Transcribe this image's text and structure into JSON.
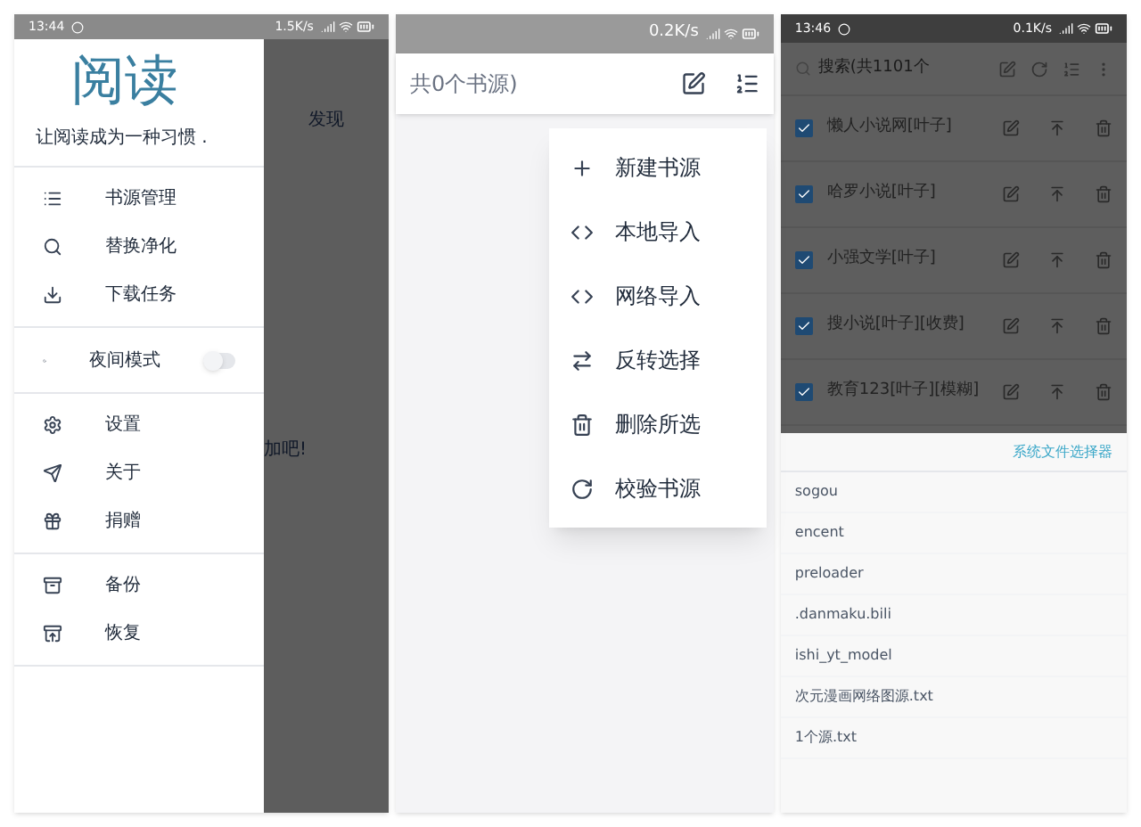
{
  "left_phone": {
    "status_bar": {
      "time": "13:44",
      "speed": "1.5K/s"
    },
    "drawer": {
      "title": "阅读",
      "subtitle": "让阅读成为一种习惯 .",
      "sections": [
        {
          "items": [
            {
              "kind": "link",
              "label": "书源管理"
            },
            {
              "kind": "link",
              "label": "替换净化"
            },
            {
              "kind": "link",
              "label": "下载任务"
            }
          ]
        },
        {
          "items": [
            {
              "kind": "toggle",
              "label": "夜间模式",
              "on": false
            }
          ]
        },
        {
          "items": [
            {
              "kind": "link",
              "label": "设置"
            },
            {
              "kind": "link",
              "label": "关于"
            },
            {
              "kind": "link",
              "label": "捐赠"
            }
          ]
        },
        {
          "items": [
            {
              "kind": "link",
              "label": "备份"
            },
            {
              "kind": "link",
              "label": "恢复"
            }
          ]
        }
      ]
    },
    "background": {
      "tab": "发现",
      "message": "加吧!"
    }
  },
  "middle_phone": {
    "status_bar": {
      "speed": "0.2K/s"
    },
    "toolbar": {
      "title": "共0个书源)"
    },
    "menu": [
      "新建书源",
      "本地导入",
      "网络导入",
      "反转选择",
      "删除所选",
      "校验书源"
    ]
  },
  "right_phone": {
    "status_bar": {
      "time": "13:46",
      "speed": "0.1K/s"
    },
    "search": {
      "placeholder": "搜索(共1101个"
    },
    "rows": [
      {
        "name": "懒人小说网[叶子]",
        "checked": true
      },
      {
        "name": "哈罗小说[叶子]",
        "checked": true
      },
      {
        "name": "小强文学[叶子]",
        "checked": true
      },
      {
        "name": "搜小说[叶子][收费]",
        "checked": true
      },
      {
        "name": "教育123[叶子][模糊]",
        "checked": true
      }
    ],
    "file_sheet": {
      "action": "系统文件选择器",
      "files": [
        "sogou",
        "encent",
        "preloader",
        ".danmaku.bili",
        "ishi_yt_model",
        "次元漫画网络图源.txt",
        "1个源.txt"
      ]
    }
  }
}
